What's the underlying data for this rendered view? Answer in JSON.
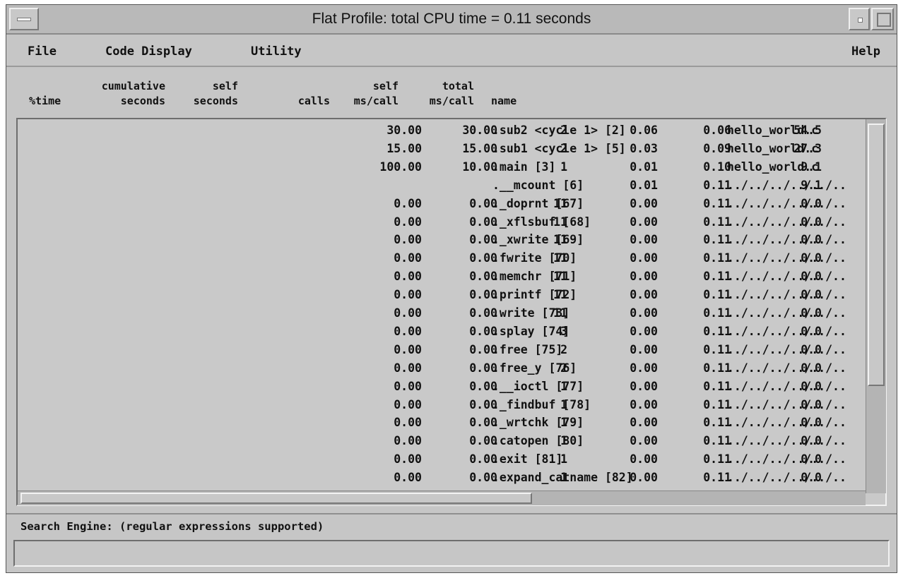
{
  "window": {
    "title": "Flat Profile:  total CPU time = 0.11 seconds"
  },
  "menubar": {
    "file": "File",
    "code_display": "Code Display",
    "utility": "Utility",
    "help": "Help"
  },
  "columns": {
    "time": "%time",
    "cum_top": "cumulative",
    "cum_bot": "seconds",
    "self_top": "self",
    "self_bot": "seconds",
    "calls": "calls",
    "selfms_top": "self",
    "selfms_bot": "ms/call",
    "totalms_top": "total",
    "totalms_bot": "ms/call",
    "name": "name"
  },
  "rows": [
    {
      "time": "54.5",
      "cum": "0.06",
      "self": "0.06",
      "calls": "2",
      "self_ms": "30.00",
      "total_ms": "30.00",
      "name": ".sub2 <cycle 1> [2]",
      "file": "hello_world.c"
    },
    {
      "time": "27.3",
      "cum": "0.09",
      "self": "0.03",
      "calls": "2",
      "self_ms": "15.00",
      "total_ms": "15.00",
      "name": ".sub1 <cycle 1> [5]",
      "file": "hello_world.c"
    },
    {
      "time": "9.1",
      "cum": "0.10",
      "self": "0.01",
      "calls": "1",
      "self_ms": "10.00",
      "total_ms": "100.00",
      "name": ".main [3]",
      "file": "hello_world.c"
    },
    {
      "time": "9.1",
      "cum": "0.11",
      "self": "0.01",
      "calls": "",
      "self_ms": "",
      "total_ms": "",
      "name": ".__mcount [6]",
      "file": "../../../../../.."
    },
    {
      "time": "0.0",
      "cum": "0.11",
      "self": "0.00",
      "calls": "11",
      "self_ms": "0.00",
      "total_ms": "0.00",
      "name": "._doprnt [67]",
      "file": "../../../../../.."
    },
    {
      "time": "0.0",
      "cum": "0.11",
      "self": "0.00",
      "calls": "11",
      "self_ms": "0.00",
      "total_ms": "0.00",
      "name": "._xflsbuf [68]",
      "file": "../../../../../.."
    },
    {
      "time": "0.0",
      "cum": "0.11",
      "self": "0.00",
      "calls": "11",
      "self_ms": "0.00",
      "total_ms": "0.00",
      "name": "._xwrite [69]",
      "file": "../../../../../.."
    },
    {
      "time": "0.0",
      "cum": "0.11",
      "self": "0.00",
      "calls": "11",
      "self_ms": "0.00",
      "total_ms": "0.00",
      "name": ".fwrite [70]",
      "file": "../../../../../.."
    },
    {
      "time": "0.0",
      "cum": "0.11",
      "self": "0.00",
      "calls": "11",
      "self_ms": "0.00",
      "total_ms": "0.00",
      "name": ".memchr [71]",
      "file": "../../../../../.."
    },
    {
      "time": "0.0",
      "cum": "0.11",
      "self": "0.00",
      "calls": "11",
      "self_ms": "0.00",
      "total_ms": "0.00",
      "name": ".printf [72]",
      "file": "../../../../../.."
    },
    {
      "time": "0.0",
      "cum": "0.11",
      "self": "0.00",
      "calls": "11",
      "self_ms": "0.00",
      "total_ms": "0.00",
      "name": ".write [73]",
      "file": "../../../../../.."
    },
    {
      "time": "0.0",
      "cum": "0.11",
      "self": "0.00",
      "calls": "3",
      "self_ms": "0.00",
      "total_ms": "0.00",
      "name": ".splay [74]",
      "file": "../../../../../.."
    },
    {
      "time": "0.0",
      "cum": "0.11",
      "self": "0.00",
      "calls": "2",
      "self_ms": "0.00",
      "total_ms": "0.00",
      "name": ".free [75]",
      "file": "../../../../../.."
    },
    {
      "time": "0.0",
      "cum": "0.11",
      "self": "0.00",
      "calls": "2",
      "self_ms": "0.00",
      "total_ms": "0.00",
      "name": ".free_y [76]",
      "file": "../../../../../.."
    },
    {
      "time": "0.0",
      "cum": "0.11",
      "self": "0.00",
      "calls": "1",
      "self_ms": "0.00",
      "total_ms": "0.00",
      "name": ".__ioctl [77]",
      "file": "../../../../../.."
    },
    {
      "time": "0.0",
      "cum": "0.11",
      "self": "0.00",
      "calls": "1",
      "self_ms": "0.00",
      "total_ms": "0.00",
      "name": "._findbuf [78]",
      "file": "../../../../../.."
    },
    {
      "time": "0.0",
      "cum": "0.11",
      "self": "0.00",
      "calls": "1",
      "self_ms": "0.00",
      "total_ms": "0.00",
      "name": "._wrtchk [79]",
      "file": "../../../../../.."
    },
    {
      "time": "0.0",
      "cum": "0.11",
      "self": "0.00",
      "calls": "1",
      "self_ms": "0.00",
      "total_ms": "0.00",
      "name": ".catopen [80]",
      "file": "../../../../../.."
    },
    {
      "time": "0.0",
      "cum": "0.11",
      "self": "0.00",
      "calls": "1",
      "self_ms": "0.00",
      "total_ms": "0.00",
      "name": ".exit [81]",
      "file": "../../../../../.."
    },
    {
      "time": "0.0",
      "cum": "0.11",
      "self": "0.00",
      "calls": "1",
      "self_ms": "0.00",
      "total_ms": "0.00",
      "name": ".expand_catname [82]",
      "file": "../../../../../.."
    }
  ],
  "search": {
    "label": "Search Engine: (regular expressions supported)",
    "value": ""
  }
}
